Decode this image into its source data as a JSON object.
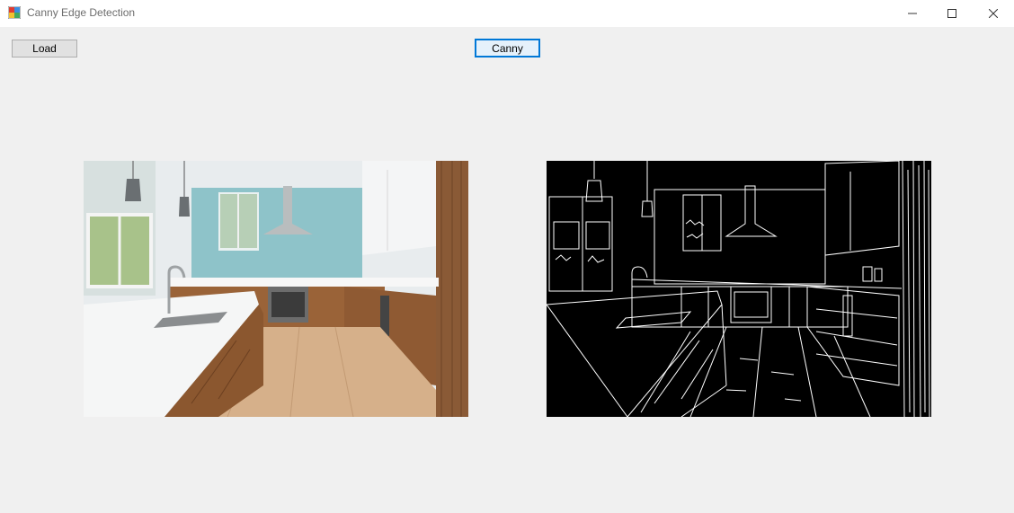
{
  "window": {
    "title": "Canny Edge Detection",
    "icons": {
      "app": "app-icon",
      "minimize": "minimize-icon",
      "maximize": "maximize-icon",
      "close": "close-icon"
    }
  },
  "toolbar": {
    "load_label": "Load",
    "canny_label": "Canny"
  },
  "images": {
    "original": "kitchen-photo",
    "edges": "kitchen-canny-edges"
  },
  "colors": {
    "focus_border": "#0078d7",
    "background": "#f0f0f0",
    "edge_background": "#000000",
    "edge_lines": "#ffffff"
  }
}
